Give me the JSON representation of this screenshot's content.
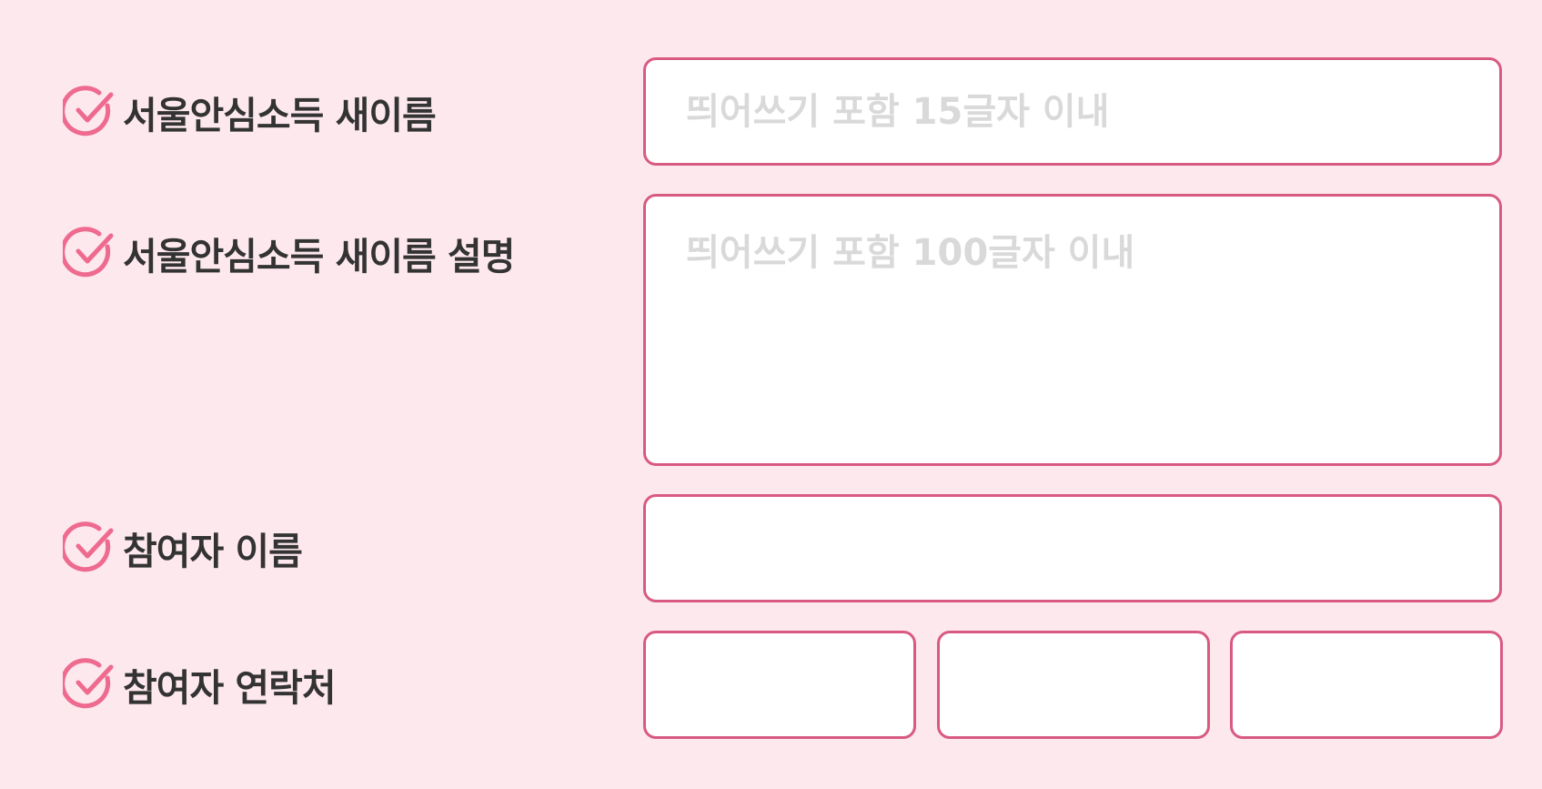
{
  "form": {
    "new_name": {
      "label": "서울안심소득 새이름",
      "placeholder": "띄어쓰기 포함 15글자 이내",
      "value": ""
    },
    "description": {
      "label": "서울안심소득 새이름 설명",
      "placeholder": "띄어쓰기 포함 100글자 이내",
      "value": ""
    },
    "participant_name": {
      "label": "참여자 이름",
      "value": ""
    },
    "participant_contact": {
      "label": "참여자 연락처",
      "parts": [
        "",
        "",
        ""
      ]
    }
  },
  "icons": {
    "label_marker": "check-circle-icon"
  },
  "colors": {
    "background": "#fde8ee",
    "accent": "#d85a82",
    "icon": "#ee6a8f",
    "label_text": "#333333",
    "placeholder": "#d9d9d9"
  }
}
